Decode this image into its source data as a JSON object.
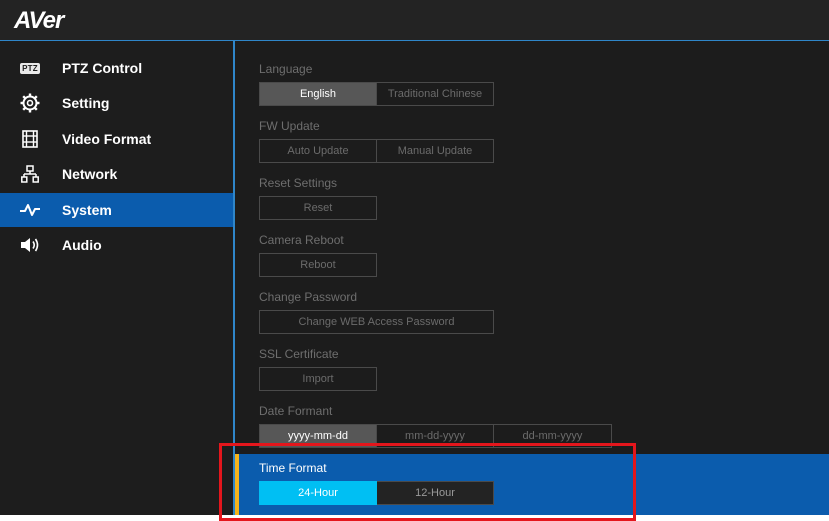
{
  "header": {
    "logo_text": "AVer"
  },
  "sidebar": {
    "items": [
      {
        "label": "PTZ Control",
        "icon": "ptz-icon",
        "badge": "PTZ"
      },
      {
        "label": "Setting",
        "icon": "gear-icon"
      },
      {
        "label": "Video Format",
        "icon": "film-icon"
      },
      {
        "label": "Network",
        "icon": "network-icon"
      },
      {
        "label": "System",
        "icon": "pulse-icon",
        "active": true
      },
      {
        "label": "Audio",
        "icon": "speaker-icon"
      }
    ]
  },
  "system": {
    "language": {
      "label": "Language",
      "options": [
        "English",
        "Traditional Chinese"
      ],
      "selected": "English"
    },
    "fw_update": {
      "label": "FW Update",
      "options": [
        "Auto Update",
        "Manual Update"
      ]
    },
    "reset": {
      "label": "Reset Settings",
      "button": "Reset"
    },
    "reboot": {
      "label": "Camera Reboot",
      "button": "Reboot"
    },
    "password": {
      "label": "Change Password",
      "button": "Change WEB Access Password"
    },
    "ssl": {
      "label": "SSL Certificate",
      "button": "Import"
    },
    "date_format": {
      "label": "Date Formant",
      "options": [
        "yyyy-mm-dd",
        "mm-dd-yyyy",
        "dd-mm-yyyy"
      ],
      "selected": "yyyy-mm-dd"
    },
    "time_format": {
      "label": "Time Format",
      "options": [
        "24-Hour",
        "12-Hour"
      ],
      "selected": "24-Hour"
    }
  },
  "colors": {
    "accent_blue": "#0b5cad",
    "selected_cyan": "#00bff3",
    "highlight_red": "#e4161c",
    "indicator_yellow": "#f6b41b"
  }
}
